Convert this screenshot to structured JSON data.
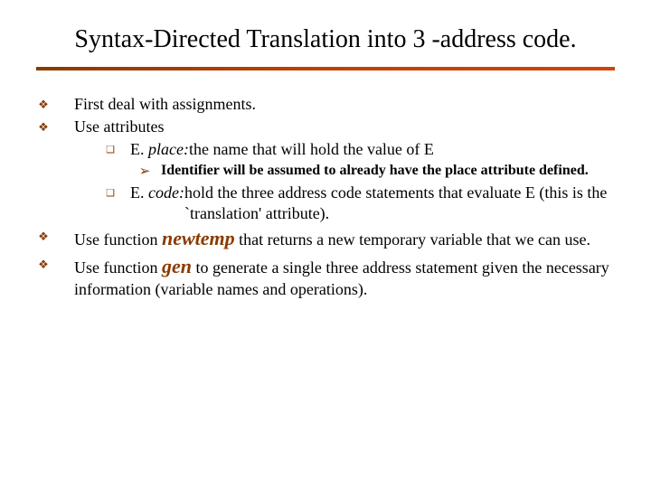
{
  "title": "Syntax-Directed Translation into 3 -address code.",
  "bullets": {
    "b1": "First deal with assignments.",
    "b2": "Use attributes",
    "b2a_lead": "E. ",
    "b2a_ital": "place: ",
    "b2a_rest": "the name that will hold the value of E",
    "b2a_note": "Identifier will be assumed to already have the place attribute defined.",
    "b2b_lead": "E. ",
    "b2b_ital": "code: ",
    "b2b_rest": "hold the three address code statements that evaluate E (this is the `translation' attribute).",
    "b3_pre": "Use function ",
    "b3_kw": "newtemp",
    "b3_post": " that returns a new temporary variable that we can use.",
    "b4_pre": "Use function ",
    "b4_kw": "gen",
    "b4_post": " to generate a single three address statement given the necessary information (variable names and operations)."
  }
}
